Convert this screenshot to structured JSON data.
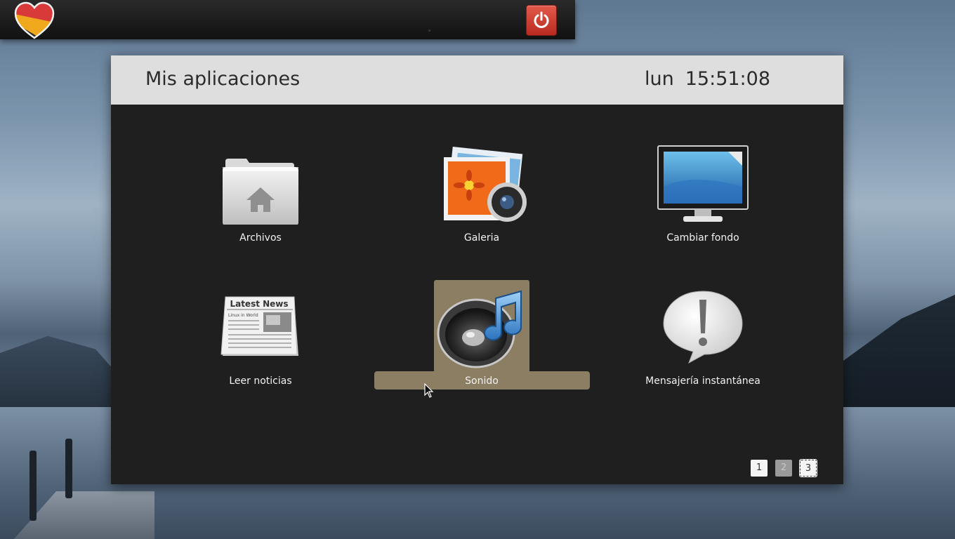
{
  "window": {
    "title": "Mis aplicaciones",
    "clock_day": "lun",
    "clock_time": "15:51:08"
  },
  "apps": [
    {
      "label": "Archivos",
      "icon": "folder-home-icon"
    },
    {
      "label": "Galeria",
      "icon": "photo-gallery-icon"
    },
    {
      "label": "Cambiar fondo",
      "icon": "monitor-wallpaper-icon"
    },
    {
      "label": "Leer noticias",
      "icon": "newspaper-icon"
    },
    {
      "label": "Sonido",
      "icon": "speaker-music-icon",
      "selected": true
    },
    {
      "label": "Mensajería instantánea",
      "icon": "exclamation-bubble-icon"
    }
  ],
  "newspaper": {
    "headline": "Latest News",
    "subheadline": "Linux in World"
  },
  "pagination": {
    "pages": [
      "1",
      "2",
      "3"
    ],
    "current": "3"
  },
  "colors": {
    "highlight": "#8b7e63",
    "power_button": "#d6433a",
    "header_bg": "#dedede",
    "window_bg": "#1f1f1f"
  }
}
